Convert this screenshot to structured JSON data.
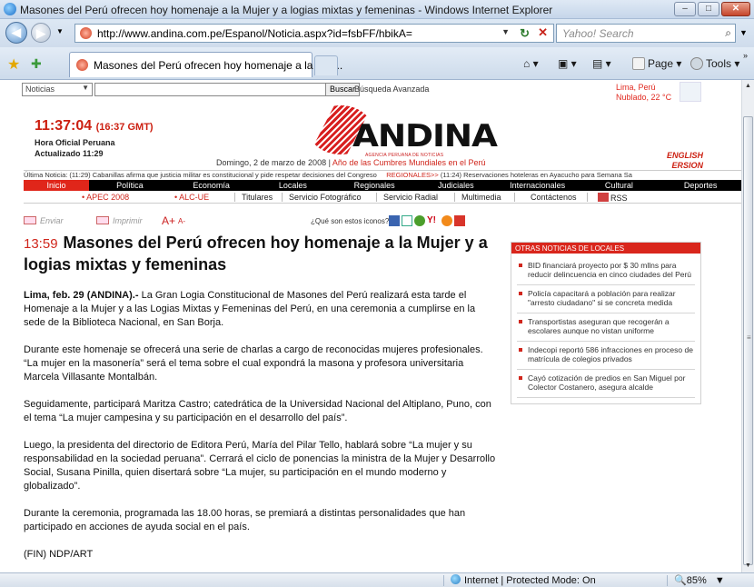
{
  "window": {
    "title": "Masones del Perú ofrecen hoy homenaje a la Mujer y a logias mixtas y femeninas - Windows Internet Explorer",
    "min": "–",
    "max": "□",
    "close": "✕"
  },
  "address_bar": {
    "url": "http://www.andina.com.pe/Espanol/Noticia.aspx?id=fsbFF/hbikA=",
    "search_placeholder": "Yahoo! Search"
  },
  "tab": {
    "label": "Masones del Perú ofrecen hoy homenaje a la Muj..."
  },
  "toolbar": {
    "page": "Page",
    "tools": "Tools"
  },
  "status": {
    "zone": "Internet | Protected Mode: On",
    "zoom": "85%"
  },
  "site": {
    "search_select": "Noticias",
    "search_button": "Buscar",
    "advanced": "Búsqueda Avanzada",
    "weather_city": "Lima, Perú",
    "weather_text": "Nublado, 22 °C",
    "clock_time": "11:37:04",
    "clock_gmt": "(16:37 GMT)",
    "official_time": "Hora Oficial Peruana",
    "updated": "Actualizado 11:29",
    "logo_text": "ANDINA",
    "logo_agency": "AGENCIA PERUANA DE NOTICIAS",
    "date": "Domingo, 2 de marzo de 2008",
    "date_tag": "Año de las Cumbres Mundiales en el Perú",
    "english_1": "ENGLISH",
    "english_2": "ERSION",
    "ticker_left": "Última Noticia: (11:29) Cabanillas afirma que justicia militar es constitucional y pide respetar decisiones del Congreso",
    "ticker_reg": "REGIONALES>>",
    "ticker_right": "(11:24) Reservaciones hoteleras en Ayacucho para Semana Sa"
  },
  "main_nav": [
    "Inicio",
    "Política",
    "Economía",
    "Locales",
    "Regionales",
    "Judiciales",
    "Internacionales",
    "Cultural",
    "Deportes"
  ],
  "sub_nav": {
    "apec": "APEC 2008",
    "alc": "ALC-UE",
    "items": [
      "Titulares",
      "Servicio Fotográfico",
      "Servicio Radial",
      "Multimedia",
      "Contáctenos"
    ],
    "rss": "RSS"
  },
  "tools": {
    "send": "Enviar",
    "print": "Imprimir",
    "aplus": "A+",
    "aminus": "A-",
    "icons_question": "¿Qué son estos iconos?"
  },
  "article": {
    "time": "13:59",
    "headline": "Masones del Perú ofrecen hoy homenaje a la Mujer y a logias mixtas y femeninas",
    "lead_bold": "Lima, feb. 29 (ANDINA).-",
    "lead": " La Gran Logia Constitucional de Masones del Perú realizará esta tarde el Homenaje a la Mujer y a las Logias Mixtas y Femeninas del Perú, en una ceremonia a cumplirse en la sede de la Biblioteca Nacional, en San Borja.",
    "p2": "Durante este homenaje se ofrecerá una serie de charlas a cargo de reconocidas mujeres profesionales. “La mujer en la masonería” será el tema sobre el cual expondrá la masona y profesora universitaria Marcela Villasante Montalbán.",
    "p3": "Seguidamente, participará Maritza Castro; catedrática de la Universidad Nacional del Altiplano, Puno, con el tema “La mujer campesina y su participación en el desarrollo del país”.",
    "p4": "Luego, la presidenta del directorio de Editora Perú, María del Pilar Tello, hablará sobre “La mujer y su responsabilidad en la sociedad peruana”. Cerrará el ciclo de ponencias la ministra de la Mujer y Desarrollo Social, Susana Pinilla, quien disertará sobre “La mujer, su participación en el mundo moderno y globalizado”.",
    "p5": "Durante la ceremonia, programada las 18.00 horas, se premiará a distintas personalidades que han participado en acciones de ayuda social en el país.",
    "p6": "(FIN) NDP/ART"
  },
  "sidebar": {
    "header": "OTRAS NOTICIAS DE LOCALES",
    "items": [
      "BID financiará proyecto por $ 30 mllns para reducir delincuencia en cinco ciudades del Perú",
      "Policía capacitará a población para realizar \"arresto ciudadano\" si se concreta medida",
      "Transportistas aseguran que recogerán a escolares aunque no vistan uniforme",
      "Indecopi reportó 586 infracciones en proceso de matrícula de colegios privados",
      "Cayó cotización de predios en San Miguel por Colector Costanero, asegura alcalde"
    ]
  }
}
